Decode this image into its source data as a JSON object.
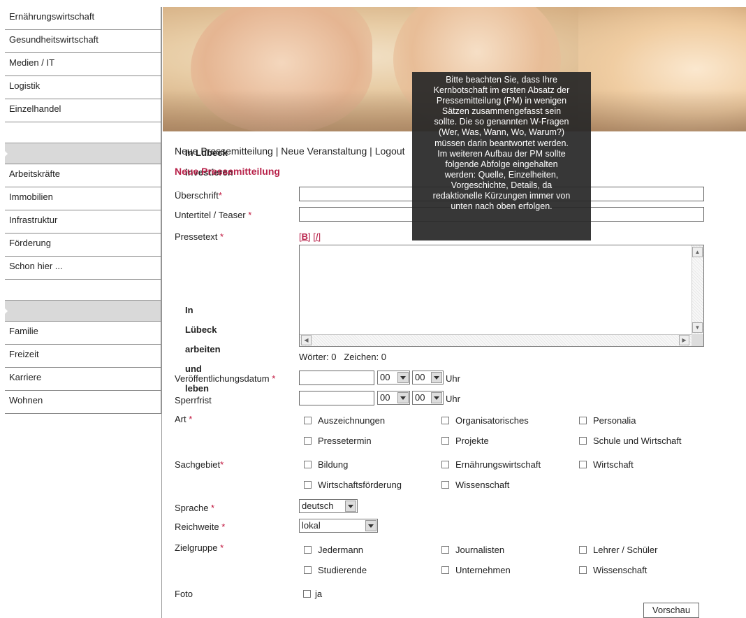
{
  "sidebar": {
    "top_items": [
      "Ernährungswirtschaft",
      "Gesundheitswirtschaft",
      "Medien / IT",
      "Logistik",
      "Einzelhandel"
    ],
    "section1": {
      "title": "In Lübeck investieren",
      "items": [
        "Arbeitskräfte",
        "Immobilien",
        "Infrastruktur",
        "Förderung",
        "Schon hier ..."
      ]
    },
    "section2": {
      "title": "In Lübeck arbeiten und leben",
      "items": [
        "Familie",
        "Freizeit",
        "Karriere",
        "Wohnen"
      ]
    }
  },
  "topnav": {
    "new_press": "Neue Pressemitteilung",
    "sep1": " | ",
    "new_event": "Neue Veranstaltung",
    "sep2": " | ",
    "logout": "Logout"
  },
  "page_title": "Neue Pressemitteilung",
  "form": {
    "required_marker": "*",
    "headline_label": "Überschrift",
    "subtitle_label": "Untertitel / Teaser",
    "presstext_label": "Pressetext",
    "bold_btn": "B",
    "italic_btn": "I",
    "counts": {
      "words": "Wörter: 0",
      "chars": "Zeichen: 0"
    },
    "pubdate_label": "Veröffentlichungsdatum",
    "embargo_label": "Sperrfrist",
    "hour_value": "00",
    "minute_value": "00",
    "uhr": "Uhr",
    "art_label": "Art",
    "art_options": [
      "Auszeichnungen",
      "Organisatorisches",
      "Personalia",
      "Pressetermin",
      "Projekte",
      "Schule und Wirtschaft"
    ],
    "sachgebiet_label": "Sachgebiet",
    "sachgebiet_options": [
      "Bildung",
      "Ernährungswirtschaft",
      "Wirtschaft",
      "Wirtschaftsförderung",
      "Wissenschaft"
    ],
    "sprache_label": "Sprache",
    "sprache_value": "deutsch",
    "reichweite_label": "Reichweite",
    "reichweite_value": "lokal",
    "zielgruppe_label": "Zielgruppe",
    "zielgruppe_options": [
      "Jedermann",
      "Journalisten",
      "Lehrer / Schüler",
      "Studierende",
      "Unternehmen",
      "Wissenschaft"
    ],
    "foto_label": "Foto",
    "foto_option": "ja",
    "preview_button": "Vorschau"
  },
  "tooltip": {
    "lines": [
      "Bitte beachten Sie, dass Ihre",
      "Kernbotschaft im ersten Absatz der",
      "Pressemitteilung (PM) in wenigen",
      "Sätzen zusammengefasst sein",
      "sollte. Die so genannten W-Fragen",
      "(Wer, Was, Wann, Wo, Warum?)",
      "müssen darin beantwortet werden.",
      "Im weiteren Aufbau der PM sollte",
      "folgende Abfolge eingehalten",
      "werden: Quelle, Einzelheiten,",
      "Vorgeschichte, Details, da",
      "redaktionelle Kürzungen immer von",
      "unten nach oben erfolgen."
    ]
  },
  "colors": {
    "accent": "#b8224a",
    "required": "#c0143c",
    "tooltip_bg": "#282828",
    "sidebar_header_bg": "#d9d9d9"
  }
}
